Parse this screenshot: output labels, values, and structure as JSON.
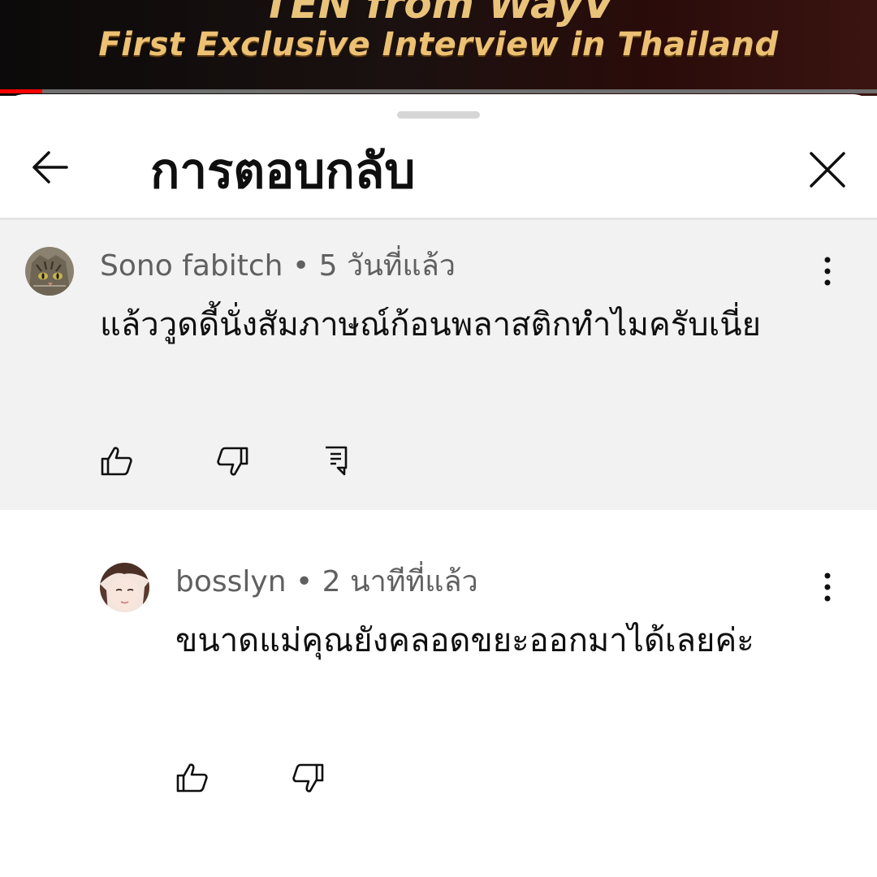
{
  "video": {
    "title_partial": "TEN from WayV",
    "subtitle": "First Exclusive Interview in Thailand",
    "progress_fraction": 0.048
  },
  "sheet": {
    "title": "การตอบกลับ",
    "back_icon": "back-arrow-icon",
    "close_icon": "close-icon"
  },
  "parent_comment": {
    "author": "Sono fabitch",
    "time": "5 วันที่แล้ว",
    "separator": "•",
    "text": "แล้ววูดดี้นั่งสัมภาษณ์ก้อนพลาสติกทำไมครับเนี่ย",
    "actions": [
      "like-icon",
      "dislike-icon",
      "reply-icon"
    ]
  },
  "reply": {
    "author": "bosslyn",
    "time": "2 นาทีที่แล้ว",
    "separator": "•",
    "text": "ขนาดแม่คุณยังคลอดขยะออกมาได้เลยค่ะ",
    "actions": [
      "like-icon",
      "dislike-icon"
    ]
  },
  "colors": {
    "accent_progress": "#ff0000",
    "parent_bg": "#f2f2f2",
    "meta_text": "#606060",
    "body_text": "#0f0f0f",
    "video_gold": "#edc173"
  }
}
